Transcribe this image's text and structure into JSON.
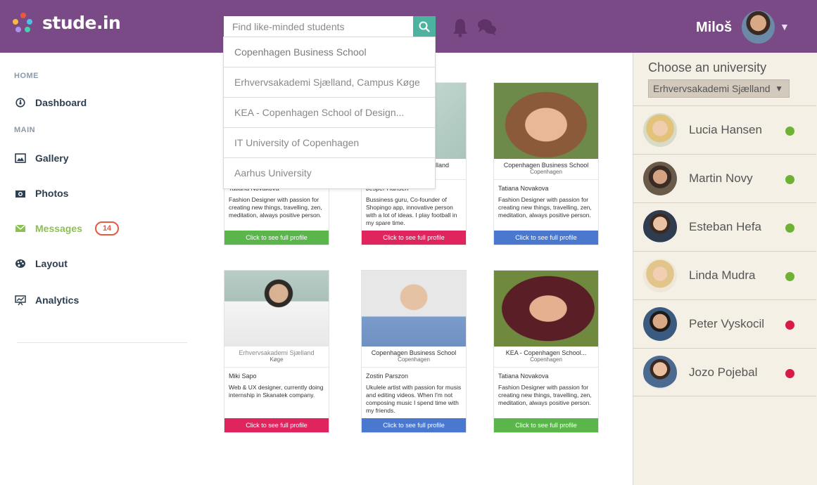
{
  "app": {
    "brand": "stude.in"
  },
  "header": {
    "search_placeholder": "Find like-minded students",
    "username": "Miloš"
  },
  "search_suggestions": [
    "Copenhagen Business School",
    "Erhvervsakademi Sjælland, Campus Køge",
    "KEA -  Copenhagen School of Design...",
    "IT University of Copenhagen",
    "Aarhus University"
  ],
  "sidebar": {
    "home_label": "HOME",
    "main_label": "MAIN",
    "items": [
      {
        "label": "Dashboard",
        "icon": "dashboard-icon"
      },
      {
        "label": "Gallery",
        "icon": "gallery-icon"
      },
      {
        "label": "Photos",
        "icon": "camera-icon"
      },
      {
        "label": "Messages",
        "icon": "envelope-icon",
        "badge": "14"
      },
      {
        "label": "Layout",
        "icon": "palette-icon"
      },
      {
        "label": "Analytics",
        "icon": "analytics-icon"
      }
    ]
  },
  "cards": [
    {
      "school": "",
      "city": "",
      "name": "Tatiana Novakova",
      "desc": "Fashion Designer with passion for creating new things, travelling, zen, meditation, always positive person.",
      "button": "Click to see full profile",
      "button_color": "#5ab54b"
    },
    {
      "school": "lland",
      "city": "",
      "name": "Jesper Hansen",
      "desc": "Bussiness guru, Co-founder of Shopingo app, innovative person with a lot of ideas. I play football in my spare time.",
      "button": "Click to see full profile",
      "button_color": "#e0245e"
    },
    {
      "school": "Copenhagen Business School",
      "city": "Copenhagen",
      "name": "Tatiana Novakova",
      "desc": "Fashion Designer with passion for creating new things, travelling, zen, meditation, always positive person.",
      "button": "Click to see full profile",
      "button_color": "#4a78cf"
    },
    {
      "school": "Erhvervsakademi Sjælland",
      "city": "Køge",
      "name": "Miki Sapo",
      "desc": "Web & UX  designer, currently doing internship in Skanatek company.",
      "button": "Click to see full profile",
      "button_color": "#e0245e"
    },
    {
      "school": "Copenhagen Business School",
      "city": "Copenhagen",
      "name": "Zostin Parszon",
      "desc": "Ukulele artist with passion for musis and editing videos. When I'm not composing music I spend time with my friends.",
      "button": "Click to see full profile",
      "button_color": "#4a78cf"
    },
    {
      "school": "KEA - Copenhagen School...",
      "city": "Copenhagen",
      "name": "Tatiana Novakova",
      "desc": "Fashion Designer with passion for creating new things, travelling, zen, meditation, always positive person.",
      "button": "Click to see full profile",
      "button_color": "#5ab54b"
    }
  ],
  "right_panel": {
    "title": "Choose an university",
    "selected_university": "Erhvervsakademi Sjælland",
    "users": [
      {
        "name": "Lucia Hansen",
        "status": "online",
        "status_color": "#6fb135"
      },
      {
        "name": "Martin Novy",
        "status": "online",
        "status_color": "#6fb135"
      },
      {
        "name": "Esteban Hefa",
        "status": "online",
        "status_color": "#6fb135"
      },
      {
        "name": "Linda Mudra",
        "status": "online",
        "status_color": "#6fb135"
      },
      {
        "name": "Peter Vyskocil",
        "status": "offline",
        "status_color": "#d81b46"
      },
      {
        "name": "Jozo Pojebal",
        "status": "offline",
        "status_color": "#d81b46"
      }
    ]
  },
  "colors": {
    "header": "#7a4a86",
    "accent": "#4bb39f",
    "active": "#8cc152",
    "badge": "#e9573f"
  }
}
